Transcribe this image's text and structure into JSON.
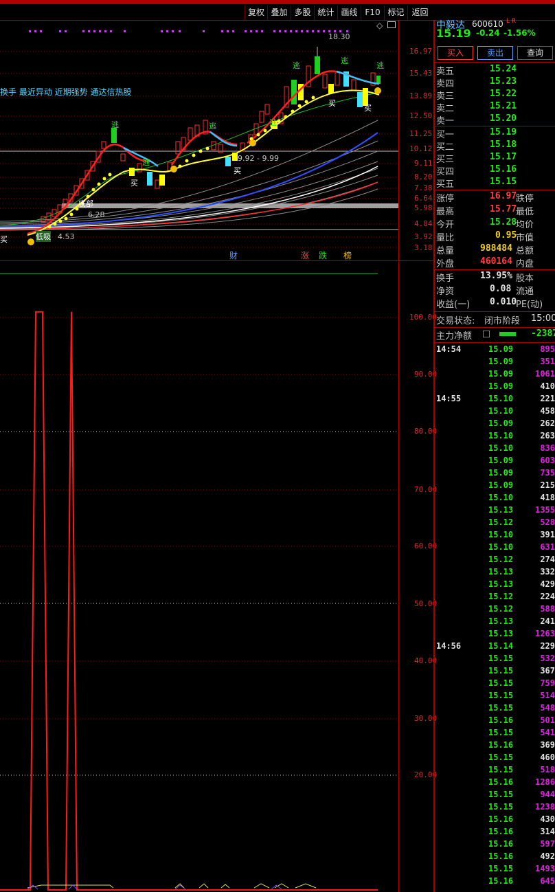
{
  "toolbar": {
    "buttons": [
      "复权",
      "叠加",
      "多股",
      "统计",
      "画线",
      "F10",
      "标记",
      "返回"
    ]
  },
  "stock": {
    "name": "中毅达",
    "code": "600610",
    "flags": "L R",
    "price": "15.19",
    "change": "-0.24",
    "change_pct": "-1.56%"
  },
  "actions": {
    "buy": "买入",
    "sell": "卖出",
    "query": "查询"
  },
  "order_book": {
    "asks": [
      {
        "label": "卖五",
        "price": "15.24"
      },
      {
        "label": "卖四",
        "price": "15.23"
      },
      {
        "label": "卖三",
        "price": "15.22"
      },
      {
        "label": "卖二",
        "price": "15.21"
      },
      {
        "label": "卖一",
        "price": "15.20"
      }
    ],
    "bids": [
      {
        "label": "买一",
        "price": "15.19"
      },
      {
        "label": "买二",
        "price": "15.18"
      },
      {
        "label": "买三",
        "price": "15.17"
      },
      {
        "label": "买四",
        "price": "15.16"
      },
      {
        "label": "买五",
        "price": "15.15"
      }
    ]
  },
  "stats": [
    {
      "label": "涨停",
      "value": "16.97",
      "label2": "跌停"
    },
    {
      "label": "最高",
      "value": "15.77",
      "label2": "最低"
    },
    {
      "label": "今开",
      "value": "15.28",
      "label2": "均价"
    },
    {
      "label": "量比",
      "value": "0.95",
      "label2": "市值"
    },
    {
      "label": "总量",
      "value": "988484",
      "label2": "总额"
    },
    {
      "label": "外盘",
      "value": "460164",
      "label2": "内盘"
    }
  ],
  "stats2": [
    {
      "label": "换手",
      "value": "13.95%",
      "label2": "股本"
    },
    {
      "label": "净资",
      "value": "0.08",
      "label2": "流通"
    },
    {
      "label": "收益(一)",
      "value": "0.010",
      "label2": "PE(动)"
    }
  ],
  "trade_status": {
    "label": "交易状态:",
    "value": "闭市阶段",
    "time": "15:00"
  },
  "main_force": {
    "label": "主力净额",
    "value": "-2387"
  },
  "ticks": [
    {
      "time": "14:54",
      "price": "15.09",
      "vol": "895",
      "c": "m"
    },
    {
      "time": "",
      "price": "15.09",
      "vol": "351",
      "c": "m"
    },
    {
      "time": "",
      "price": "15.09",
      "vol": "1061",
      "c": "m"
    },
    {
      "time": "",
      "price": "15.09",
      "vol": "410",
      "c": "y"
    },
    {
      "time": "14:55",
      "price": "15.10",
      "vol": "221",
      "c": "y"
    },
    {
      "time": "",
      "price": "15.10",
      "vol": "458",
      "c": "y"
    },
    {
      "time": "",
      "price": "15.09",
      "vol": "262",
      "c": "y"
    },
    {
      "time": "",
      "price": "15.10",
      "vol": "263",
      "c": "y"
    },
    {
      "time": "",
      "price": "15.10",
      "vol": "836",
      "c": "m"
    },
    {
      "time": "",
      "price": "15.09",
      "vol": "603",
      "c": "m"
    },
    {
      "time": "",
      "price": "15.09",
      "vol": "735",
      "c": "m"
    },
    {
      "time": "",
      "price": "15.09",
      "vol": "215",
      "c": "y"
    },
    {
      "time": "",
      "price": "15.10",
      "vol": "418",
      "c": "y"
    },
    {
      "time": "",
      "price": "15.13",
      "vol": "1355",
      "c": "m"
    },
    {
      "time": "",
      "price": "15.12",
      "vol": "528",
      "c": "m"
    },
    {
      "time": "",
      "price": "15.10",
      "vol": "391",
      "c": "y"
    },
    {
      "time": "",
      "price": "15.10",
      "vol": "631",
      "c": "m"
    },
    {
      "time": "",
      "price": "15.12",
      "vol": "274",
      "c": "y"
    },
    {
      "time": "",
      "price": "15.13",
      "vol": "332",
      "c": "y"
    },
    {
      "time": "",
      "price": "15.13",
      "vol": "429",
      "c": "y"
    },
    {
      "time": "",
      "price": "15.12",
      "vol": "224",
      "c": "y"
    },
    {
      "time": "",
      "price": "15.12",
      "vol": "588",
      "c": "m"
    },
    {
      "time": "",
      "price": "15.13",
      "vol": "241",
      "c": "y"
    },
    {
      "time": "",
      "price": "15.13",
      "vol": "1263",
      "c": "m"
    },
    {
      "time": "14:56",
      "price": "15.14",
      "vol": "229",
      "c": "y"
    },
    {
      "time": "",
      "price": "15.15",
      "vol": "532",
      "c": "m"
    },
    {
      "time": "",
      "price": "15.15",
      "vol": "367",
      "c": "y"
    },
    {
      "time": "",
      "price": "15.15",
      "vol": "759",
      "c": "m"
    },
    {
      "time": "",
      "price": "15.15",
      "vol": "514",
      "c": "m"
    },
    {
      "time": "",
      "price": "15.15",
      "vol": "548",
      "c": "m"
    },
    {
      "time": "",
      "price": "15.16",
      "vol": "501",
      "c": "m"
    },
    {
      "time": "",
      "price": "15.15",
      "vol": "541",
      "c": "m"
    },
    {
      "time": "",
      "price": "15.16",
      "vol": "369",
      "c": "y"
    },
    {
      "time": "",
      "price": "15.15",
      "vol": "460",
      "c": "y"
    },
    {
      "time": "",
      "price": "15.15",
      "vol": "518",
      "c": "m"
    },
    {
      "time": "",
      "price": "15.16",
      "vol": "1286",
      "c": "m"
    },
    {
      "time": "",
      "price": "15.15",
      "vol": "944",
      "c": "m"
    },
    {
      "time": "",
      "price": "15.15",
      "vol": "1238",
      "c": "m"
    },
    {
      "time": "",
      "price": "15.16",
      "vol": "430",
      "c": "y"
    },
    {
      "time": "",
      "price": "15.16",
      "vol": "314",
      "c": "y"
    },
    {
      "time": "",
      "price": "15.16",
      "vol": "597",
      "c": "m"
    },
    {
      "time": "",
      "price": "15.16",
      "vol": "492",
      "c": "y"
    },
    {
      "time": "",
      "price": "15.15",
      "vol": "1493",
      "c": "m"
    },
    {
      "time": "",
      "price": "15.16",
      "vol": "645",
      "c": "m"
    }
  ],
  "chart": {
    "indicator_text": "换手 最近异动 近期强势 通达信热股",
    "price_axis": [
      "16.97",
      "15.43",
      "13.89",
      "12.50",
      "11.25",
      "10.12",
      "9.11",
      "8.20",
      "7.38",
      "6.64",
      "5.98",
      "4.84",
      "3.92",
      "3.18"
    ],
    "osc_axis": [
      "100.00",
      "90.00",
      "80.00",
      "70.00",
      "60.00",
      "50.00",
      "40.00",
      "30.00",
      "20.00"
    ],
    "annotations": {
      "high": "18.30",
      "range": "9.92 - 9.99",
      "low1": "6.28",
      "low2": "4.53",
      "marker_buy": "买",
      "marker_flee": "逃",
      "marker_lowbuy": "低吸",
      "marker_tag": "底部"
    },
    "bottom_tags": [
      "财",
      "涨",
      "跌",
      "榜"
    ]
  },
  "chart_data": {
    "type": "line",
    "title": "",
    "ylim": [
      0,
      100
    ],
    "series": [
      {
        "values": [
          0,
          0,
          101,
          101,
          0,
          0,
          101,
          0,
          0
        ]
      }
    ]
  }
}
